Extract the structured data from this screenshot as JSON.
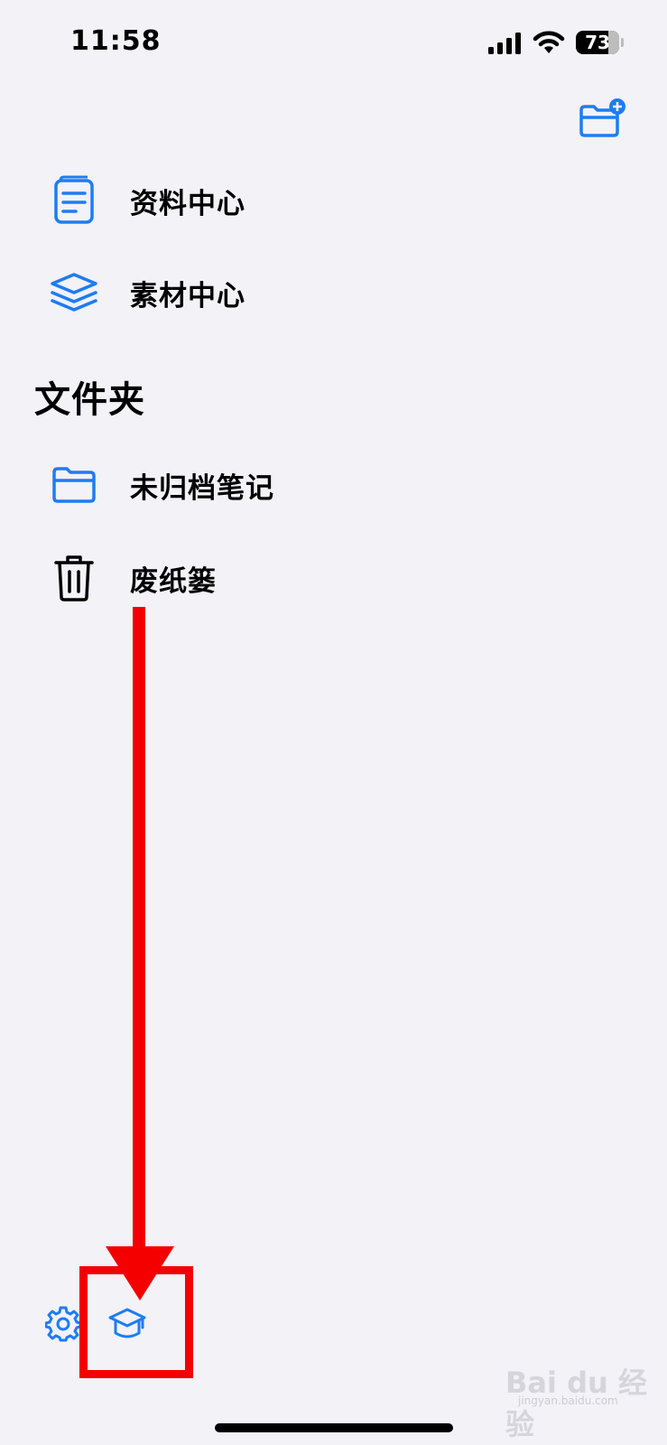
{
  "status_bar": {
    "time": "11:58",
    "battery": "73"
  },
  "sidebar": {
    "items": [
      {
        "label": "资料中心",
        "icon": "document-icon"
      },
      {
        "label": "素材中心",
        "icon": "layers-icon"
      }
    ],
    "folders_section": {
      "title": "文件夹",
      "items": [
        {
          "label": "未归档笔记",
          "icon": "folder-icon"
        },
        {
          "label": "废纸篓",
          "icon": "trash-icon"
        }
      ]
    }
  },
  "bottom_bar": {
    "settings_icon": "gear-icon",
    "learn_icon": "graduation-cap-icon"
  },
  "watermark": {
    "text": "Bai du 经验",
    "sub": "jingyan.baidu.com"
  },
  "colors": {
    "accent": "#1E7CF2",
    "annotation": "#F40000",
    "background": "#F2F2F7"
  }
}
